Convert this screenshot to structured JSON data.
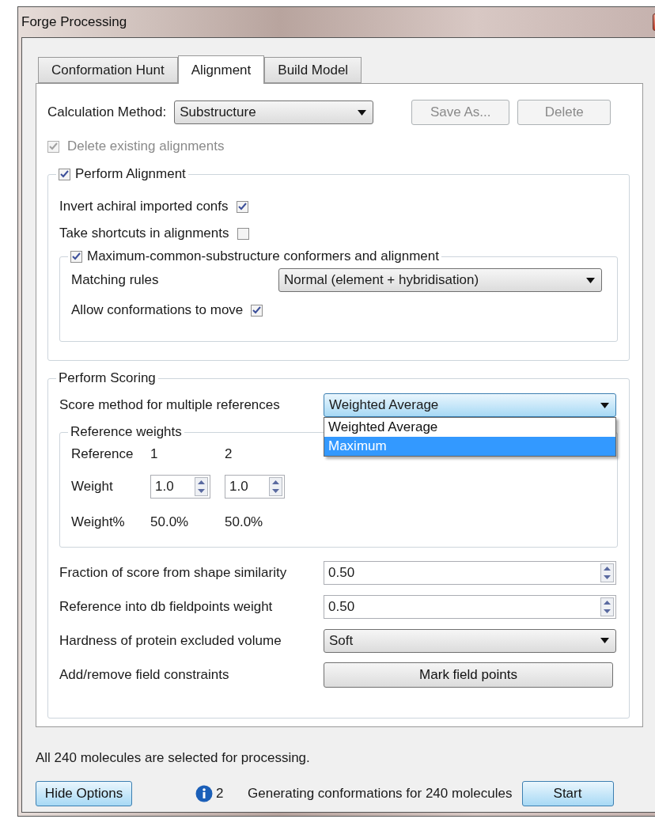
{
  "window": {
    "title": "Forge Processing"
  },
  "tabs": [
    {
      "label": "Conformation Hunt",
      "selected": false
    },
    {
      "label": "Alignment",
      "selected": true
    },
    {
      "label": "Build Model",
      "selected": false
    }
  ],
  "calculation_method": {
    "label": "Calculation Method:",
    "value": "Substructure"
  },
  "buttons": [
    {
      "label": "Save As...",
      "disabled": true
    },
    {
      "label": "Delete",
      "disabled": true
    }
  ],
  "delete_existing": {
    "label": "Delete existing alignments",
    "checked": true,
    "disabled": true
  },
  "perform_alignment": {
    "label": "Perform Alignment",
    "checked": true,
    "options": [
      {
        "label": "Invert achiral imported confs",
        "checked": true
      },
      {
        "label": "Take shortcuts in alignments",
        "checked": false
      }
    ],
    "mcs": {
      "label": "Maximum-common-substructure conformers and alignment",
      "checked": true,
      "matching_rules": {
        "label": "Matching rules",
        "value": "Normal (element + hybridisation)"
      },
      "allow_move": {
        "label": "Allow conformations to move",
        "checked": true
      }
    }
  },
  "perform_scoring": {
    "title": "Perform Scoring",
    "score_method": {
      "label": "Score method for multiple references",
      "value": "Weighted Average",
      "options": [
        {
          "label": "Weighted Average",
          "highlighted": false
        },
        {
          "label": "Maximum",
          "highlighted": true
        }
      ]
    },
    "reference_weights": {
      "title": "Reference weights",
      "reference_label": "Reference",
      "weight_label": "Weight",
      "percent_label": "Weight%",
      "references": [
        {
          "index": "1",
          "weight": "1.0",
          "percent": "50.0%"
        },
        {
          "index": "2",
          "weight": "1.0",
          "percent": "50.0%"
        }
      ]
    },
    "fields": [
      {
        "kind": "spin",
        "label": "Fraction of score from shape similarity",
        "value": "0.50"
      },
      {
        "kind": "spin",
        "label": "Reference into db fieldpoints weight",
        "value": "0.50"
      },
      {
        "kind": "select",
        "label": "Hardness of protein excluded volume",
        "value": "Soft"
      },
      {
        "kind": "button",
        "label": "Add/remove field constraints",
        "value": "Mark field points"
      }
    ]
  },
  "status": {
    "message": "All 240 molecules are selected for processing.",
    "hide_button": "Hide Options",
    "info_count": "2",
    "progress": "Generating conformations for 240 molecules",
    "start_button": "Start"
  }
}
